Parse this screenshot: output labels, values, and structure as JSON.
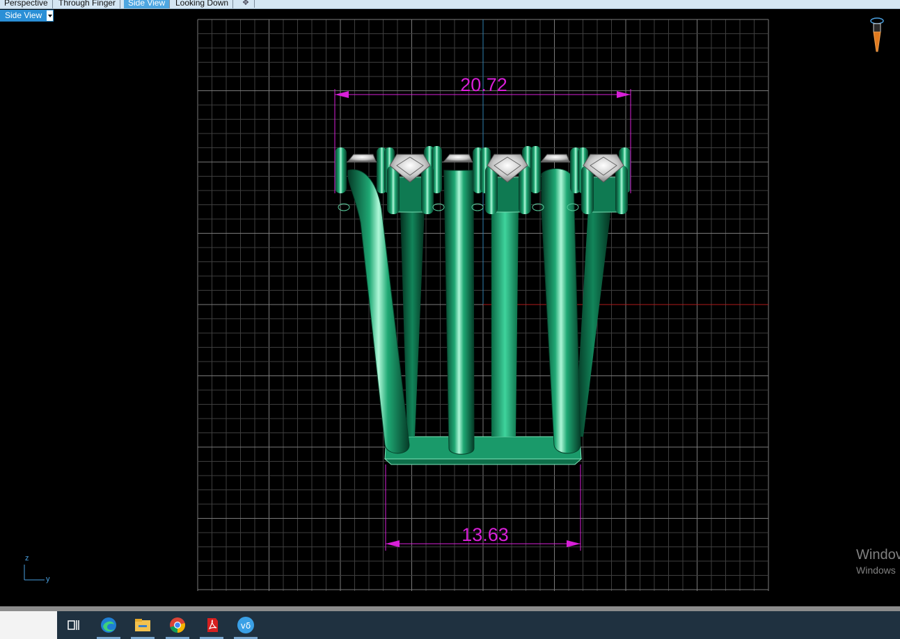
{
  "tabs": [
    {
      "label": "Perspective",
      "active": false
    },
    {
      "label": "Through Finger",
      "active": false
    },
    {
      "label": "Side View",
      "active": true
    },
    {
      "label": "Looking Down",
      "active": false
    }
  ],
  "add_tab_icon": "plus-icon",
  "view_selector": {
    "label": "Side View",
    "icon": "dropdown-arrow-icon"
  },
  "dimensions": {
    "top_width": "20.72",
    "bottom_width": "13.63"
  },
  "axes": {
    "vertical": "z",
    "horizontal": "y"
  },
  "watermark": {
    "line1": "Windov",
    "line2": "Windows"
  },
  "taskbar": {
    "icons": [
      "task-view-icon",
      "edge-icon",
      "file-explorer-icon",
      "chrome-icon",
      "acrobat-icon",
      "app-icon"
    ]
  },
  "colors": {
    "background": "#000000",
    "grid": "#595959",
    "dimension": "#d81fd8",
    "model": "#0d8a5c",
    "tab_active": "#4ea7e1"
  }
}
